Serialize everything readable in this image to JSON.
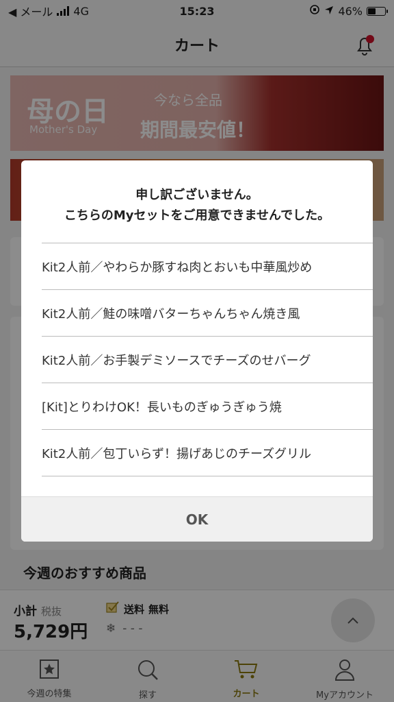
{
  "status_bar": {
    "carrier": "◀ メール",
    "network": "4G",
    "time": "15:23",
    "battery": "46%",
    "battery_level": 0.46
  },
  "nav": {
    "title": "カート"
  },
  "banner": {
    "title": "母の日",
    "subtitle": "Mother's Day",
    "now_text": "今なら全品",
    "big_text": "期間最安値！"
  },
  "dialog": {
    "message_line1": "申し訳ございません。",
    "message_line2": "こちらのMyセットをご用意できませんでした。",
    "items": [
      "Kit2人前／やわらか豚すね肉とおいも中華風炒め",
      "Kit2人前／鮭の味噌バターちゃんちゃん焼き風",
      "Kit2人前／お手製デミソースでチーズのせバーグ",
      "[Kit]とりわけOK！長いものぎゅうぎゅう焼",
      "Kit2人前／包丁いらず！揚げあじのチーズグリル"
    ],
    "ok_label": "OK"
  },
  "recommend_heading": "今週のおすすめ商品",
  "subtotal": {
    "label": "小計",
    "tax_label": "税抜",
    "amount": "5,729円",
    "shipping_label": "送料",
    "shipping_value": "無料",
    "cold_value": "- - -"
  },
  "tabs": [
    {
      "label": "今週の特集",
      "icon": "star-icon"
    },
    {
      "label": "探す",
      "icon": "search-icon"
    },
    {
      "label": "カート",
      "icon": "cart-icon"
    },
    {
      "label": "Myアカウント",
      "icon": "person-icon"
    }
  ],
  "colors": {
    "accent": "#8c7a10",
    "notification_dot": "#d0112b"
  }
}
